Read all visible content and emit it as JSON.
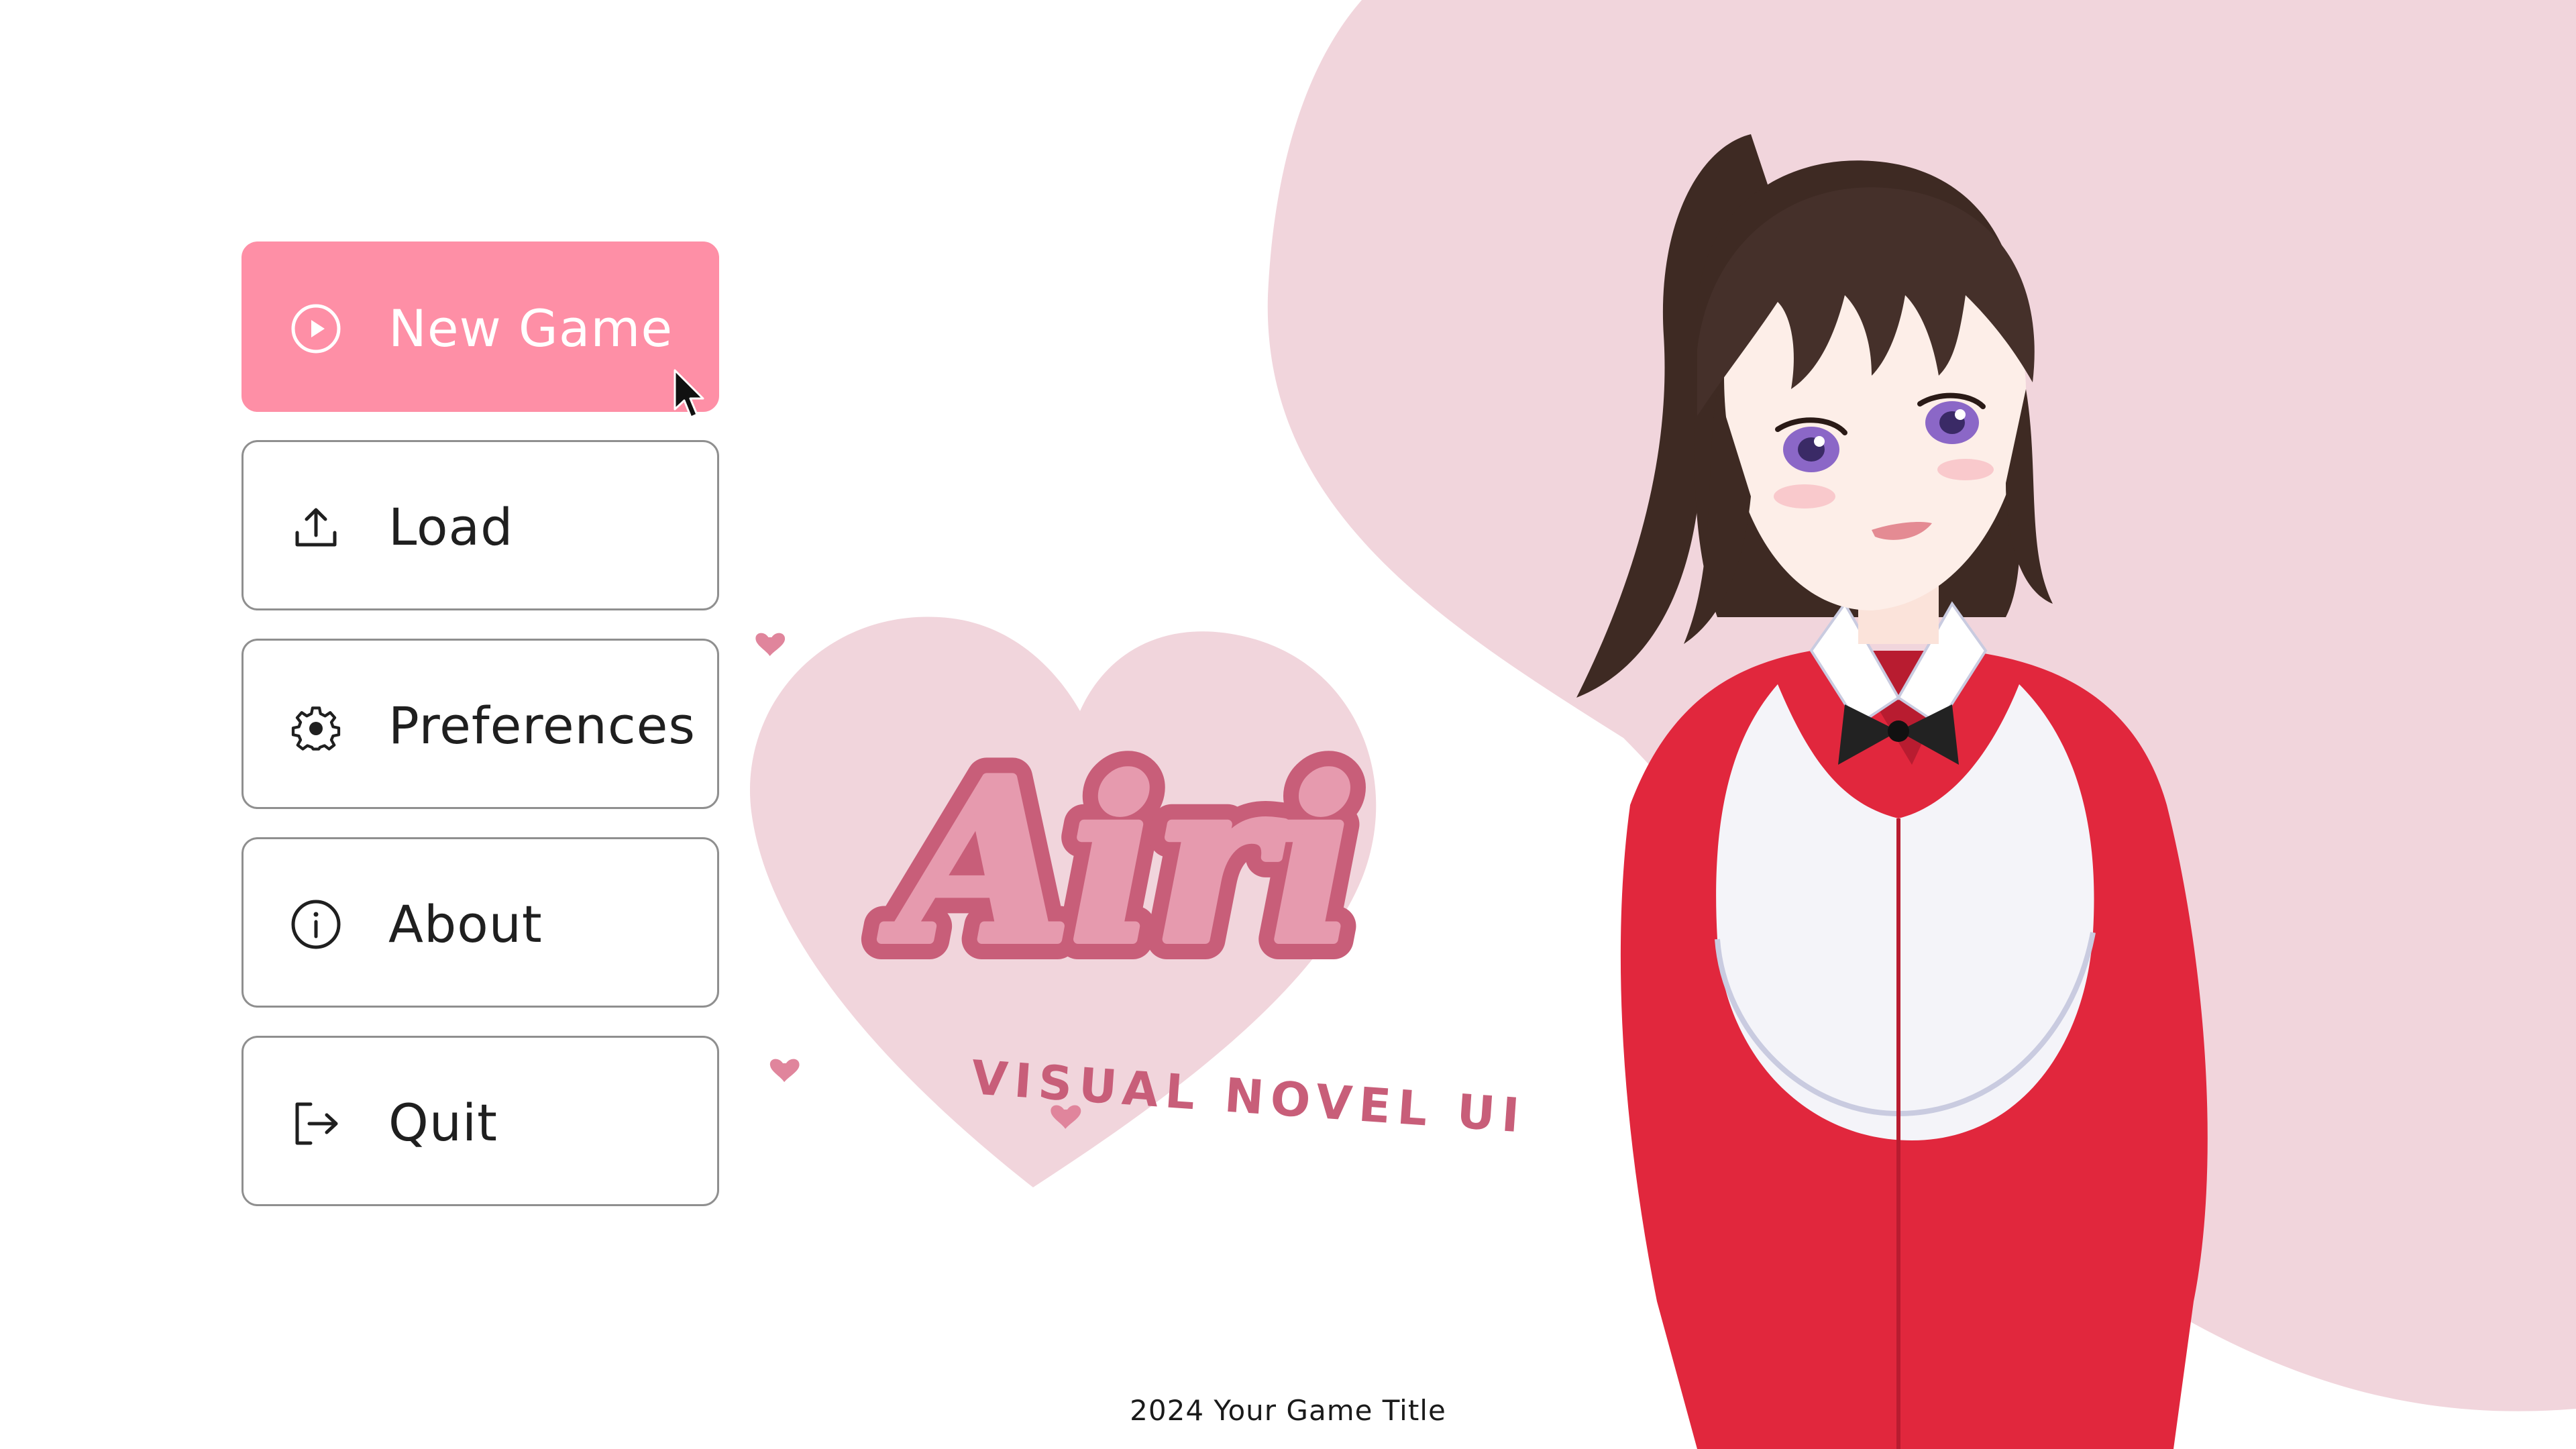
{
  "menu": {
    "items": [
      {
        "label": "New Game",
        "icon": "play-circle-icon",
        "active": true
      },
      {
        "label": "Load",
        "icon": "upload-icon",
        "active": false
      },
      {
        "label": "Preferences",
        "icon": "gear-icon",
        "active": false
      },
      {
        "label": "About",
        "icon": "info-icon",
        "active": false
      },
      {
        "label": "Quit",
        "icon": "logout-icon",
        "active": false
      }
    ]
  },
  "logo": {
    "title": "Airi",
    "tagline": "VISUAL NOVEL UI"
  },
  "footer": {
    "text": "2024 Your Game Title"
  },
  "colors": {
    "accent": "#fe8fa6",
    "background_blob": "#f1d5dc",
    "logo_heart": "#f1d5dc",
    "logo_text": "#c85e79",
    "border": "#8f8f8f"
  }
}
